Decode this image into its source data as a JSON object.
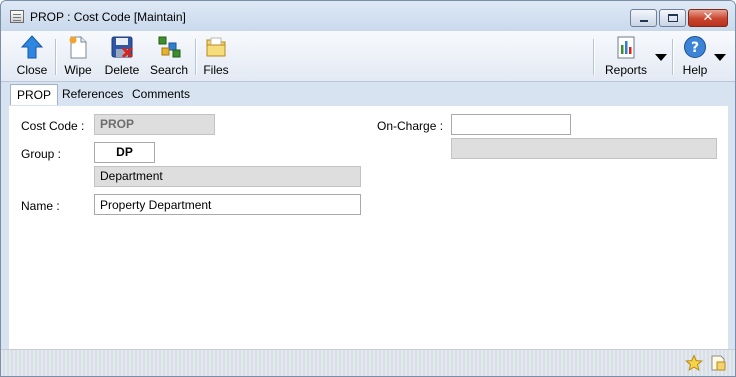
{
  "window": {
    "title": "PROP : Cost Code [Maintain]",
    "close_glyph": "✕"
  },
  "toolbar": {
    "close": "Close",
    "wipe": "Wipe",
    "delete": "Delete",
    "search": "Search",
    "files": "Files",
    "reports": "Reports",
    "help": "Help"
  },
  "tabs": [
    "PROP",
    "References",
    "Comments"
  ],
  "form": {
    "cost_code_label": "Cost Code :",
    "cost_code_value": "PROP",
    "group_label": "Group :",
    "group_code": "DP",
    "group_description": "Department",
    "name_label": "Name :",
    "name_value": "Property Department",
    "on_charge_label": "On-Charge :",
    "on_charge_value": "",
    "on_charge_description": ""
  },
  "colors": {
    "accent": "#1e73d2",
    "window_frame": "#d7e3f1",
    "close_button": "#c9452e"
  },
  "icons": [
    "window-icon",
    "close-arrow-icon",
    "wipe-icon",
    "delete-icon",
    "search-icon",
    "files-icon",
    "reports-icon",
    "help-icon",
    "favourite-star-icon",
    "notes-icon"
  ]
}
